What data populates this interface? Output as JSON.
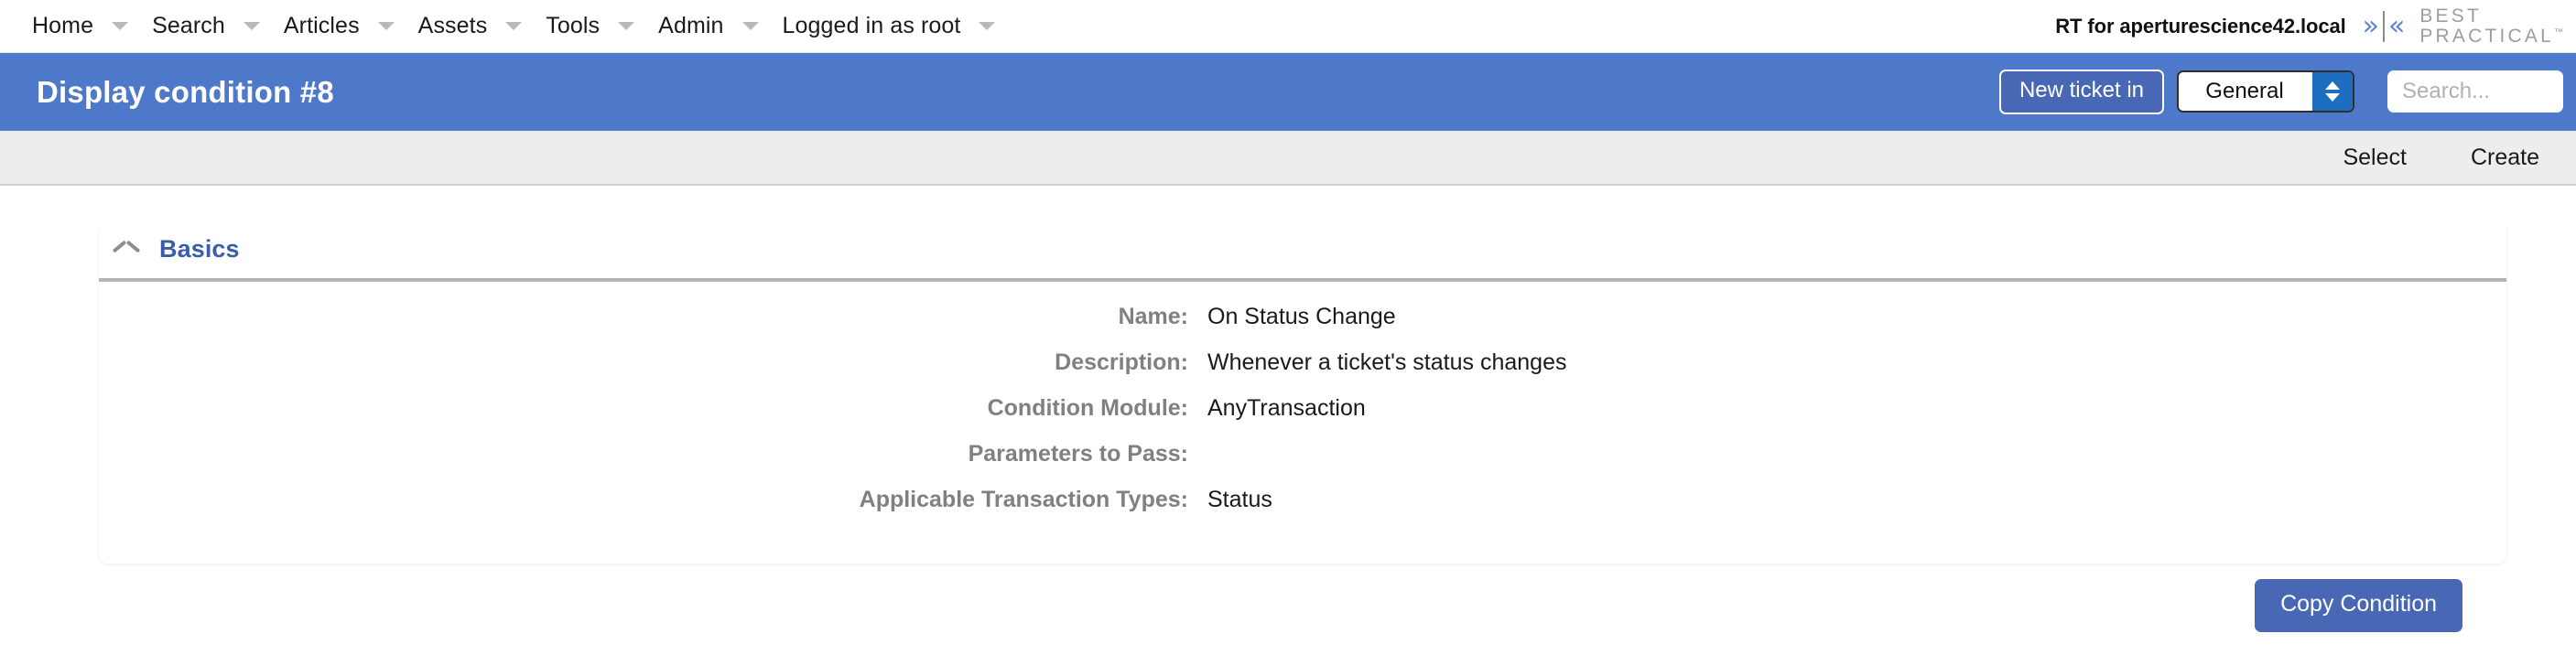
{
  "nav": {
    "items": [
      {
        "label": "Home",
        "caret": "chevron-down-icon"
      },
      {
        "label": "Search",
        "caret": "chevron-down-icon"
      },
      {
        "label": "Articles",
        "caret": "chevron-down-icon"
      },
      {
        "label": "Assets",
        "caret": "chevron-down-icon"
      },
      {
        "label": "Tools",
        "caret": "chevron-down-icon"
      },
      {
        "label": "Admin",
        "caret": "chevron-down-icon"
      },
      {
        "label": "Logged in as root",
        "caret": "chevron-down-icon"
      }
    ],
    "instance_title": "RT for aperturescience42.local",
    "chevron_right": "»",
    "chevron_left": "«",
    "logo": {
      "line1": "BEST",
      "line2": "PRACTICAL",
      "tm": "™"
    }
  },
  "header": {
    "title": "Display condition #8",
    "new_ticket_label": "New ticket in",
    "queue_selected": "General",
    "queue_options": [
      "General"
    ],
    "search_placeholder": "Search..."
  },
  "subtoolbar": {
    "links": [
      {
        "label": "Select"
      },
      {
        "label": "Create"
      }
    ]
  },
  "basics": {
    "section_title": "Basics",
    "fields": [
      {
        "label": "Name:",
        "value": "On Status Change"
      },
      {
        "label": "Description:",
        "value": "Whenever a ticket's status changes"
      },
      {
        "label": "Condition Module:",
        "value": "AnyTransaction"
      },
      {
        "label": "Parameters to Pass:",
        "value": ""
      },
      {
        "label": "Applicable Transaction Types:",
        "value": "Status"
      }
    ]
  },
  "footer": {
    "copy_condition_label": "Copy Condition"
  },
  "colors": {
    "header_blue": "#4e78ca",
    "button_blue": "#4868b5",
    "section_title_blue": "#3a5da9",
    "label_gray": "#808080",
    "subbar_gray": "#ededed"
  }
}
